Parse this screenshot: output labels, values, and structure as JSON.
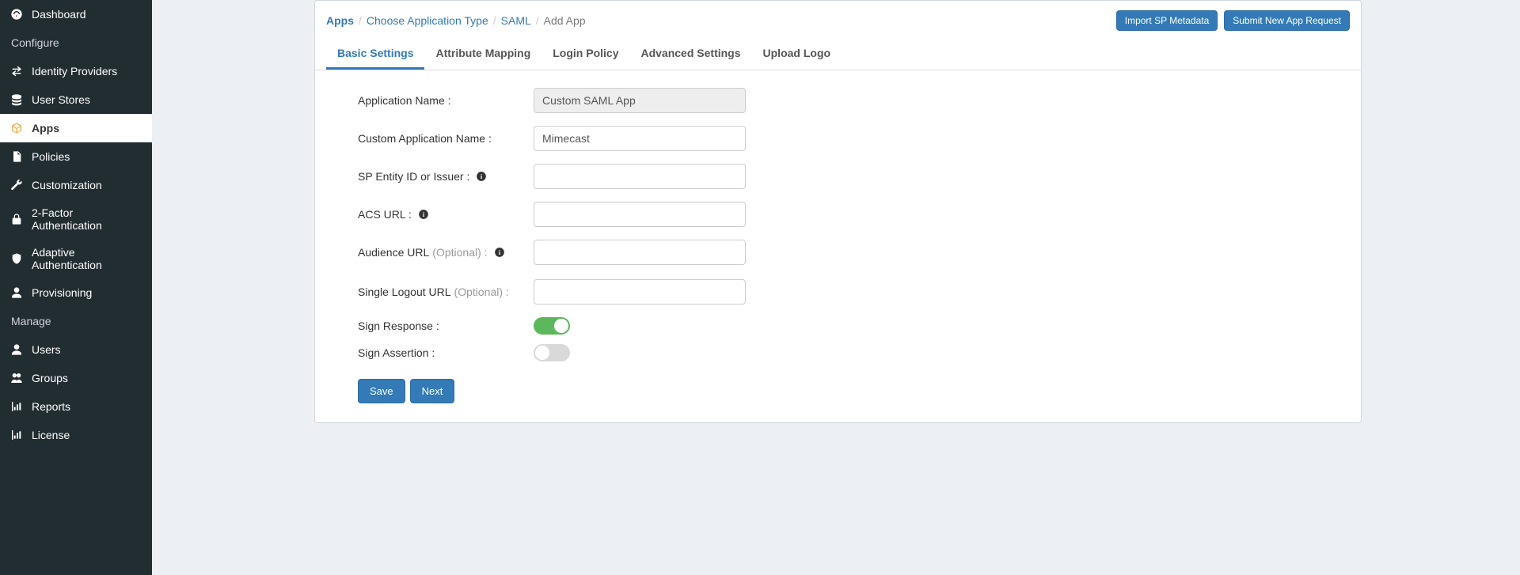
{
  "sidebar": {
    "dashboard": "Dashboard",
    "header_configure": "Configure",
    "identity_providers": "Identity Providers",
    "user_stores": "User Stores",
    "apps": "Apps",
    "policies": "Policies",
    "customization": "Customization",
    "two_factor": "2-Factor Authentication",
    "adaptive_auth": "Adaptive Authentication",
    "provisioning": "Provisioning",
    "header_manage": "Manage",
    "users": "Users",
    "groups": "Groups",
    "reports": "Reports",
    "license": "License"
  },
  "header": {
    "breadcrumb": {
      "apps": "Apps",
      "choose_type": "Choose Application Type",
      "saml": "SAML",
      "current": "Add App"
    },
    "import_btn": "Import SP Metadata",
    "submit_btn": "Submit New App Request"
  },
  "tabs": {
    "basic": "Basic Settings",
    "attribute": "Attribute Mapping",
    "login": "Login Policy",
    "advanced": "Advanced Settings",
    "logo": "Upload Logo"
  },
  "form": {
    "app_name_label": "Application Name :",
    "app_name_value": "Custom SAML App",
    "custom_name_label": "Custom Application Name :",
    "custom_name_value": "Mimecast",
    "sp_entity_label": "SP Entity ID or Issuer :",
    "sp_entity_value": "",
    "acs_url_label": "ACS URL :",
    "acs_url_value": "",
    "audience_label_main": "Audience URL ",
    "audience_label_optional": "(Optional) :",
    "audience_value": "",
    "slo_label_main": "Single Logout URL ",
    "slo_label_optional": "(Optional) :",
    "slo_value": "",
    "sign_response_label": "Sign Response :",
    "sign_assertion_label": "Sign Assertion :"
  },
  "buttons": {
    "save": "Save",
    "next": "Next"
  }
}
